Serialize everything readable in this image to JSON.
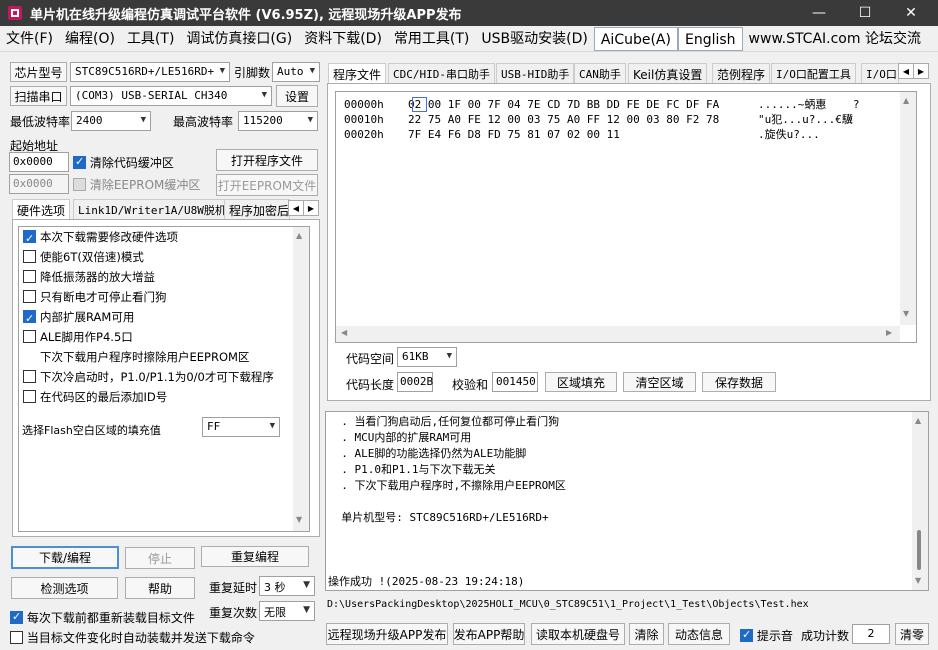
{
  "window": {
    "title": "单片机在线升级编程仿真调试平台软件 (V6.95Z), 远程现场升级APP发布"
  },
  "menu": [
    "文件(F)",
    "编程(O)",
    "工具(T)",
    "调试仿真接口(G)",
    "资料下载(D)",
    "常用工具(T)",
    "USB驱动安装(D)",
    "AiCube(A)",
    "English",
    "www.STCAI.com 论坛交流"
  ],
  "left": {
    "chip_label": "芯片型号",
    "chip_value": "STC89C516RD+/LE516RD+",
    "pin_label": "引脚数",
    "pin_value": "Auto",
    "scan_button": "扫描串口",
    "port_value": "(COM3) USB-SERIAL CH340",
    "settings_button": "设置",
    "min_baud_label": "最低波特率",
    "min_baud_value": "2400",
    "max_baud_label": "最高波特率",
    "max_baud_value": "115200",
    "start_addr_label": "起始地址",
    "code_addr_value": "0x0000",
    "clear_code_label": "清除代码缓冲区",
    "open_program_button": "打开程序文件",
    "eeprom_addr_value": "0x0000",
    "clear_eeprom_label": "清除EEPROM缓冲区",
    "open_eeprom_button": "打开EEPROM文件",
    "tabs": [
      "硬件选项",
      "Link1D/Writer1A/U8W脱机",
      "程序加密后"
    ],
    "options": [
      {
        "label": "本次下载需要修改硬件选项",
        "checked": true,
        "has_box": true
      },
      {
        "label": "使能6T(双倍速)模式",
        "checked": false,
        "has_box": true
      },
      {
        "label": "降低振荡器的放大增益",
        "checked": false,
        "has_box": true
      },
      {
        "label": "只有断电才可停止看门狗",
        "checked": false,
        "has_box": true
      },
      {
        "label": "内部扩展RAM可用",
        "checked": true,
        "has_box": true
      },
      {
        "label": "ALE脚用作P4.5口",
        "checked": false,
        "has_box": true
      },
      {
        "label": "下次下载用户程序时擦除用户EEPROM区",
        "checked": false,
        "has_box": false
      },
      {
        "label": "下次冷启动时，P1.0/P1.1为0/0才可下载程序",
        "checked": false,
        "has_box": true
      },
      {
        "label": "在代码区的最后添加ID号",
        "checked": false,
        "has_box": true
      }
    ],
    "fill_label": "选择Flash空白区域的填充值",
    "fill_value": "FF",
    "download_button": "下载/编程",
    "stop_button": "停止",
    "reprogram_button": "重复编程",
    "check_options_button": "检测选项",
    "help_button": "帮助",
    "repeat_delay_label": "重复延时",
    "repeat_delay_value": "3 秒",
    "repeat_count_label": "重复次数",
    "repeat_count_value": "无限",
    "reload_label": "每次下载前都重新装载目标文件",
    "auto_send_label": "当目标文件变化时自动装载并发送下载命令"
  },
  "right": {
    "tabs": [
      "程序文件",
      "CDC/HID-串口助手",
      "USB-HID助手",
      "CAN助手",
      "Keil仿真设置",
      "范例程序",
      "I/O口配置工具",
      "I/O口"
    ],
    "hex_rows": [
      {
        "addr": "00000h",
        "bytes": "02 00 1F 00 7F 04 7E CD 7D BB DD FE DE FC DF FA",
        "ascii": "......~蛃惠    ?"
      },
      {
        "addr": "00010h",
        "bytes": "22 75 A0 FE 12 00 03 75 A0 FF 12 00 03 80 F2 78",
        "ascii": "\"u犯...u?...€驥"
      },
      {
        "addr": "00020h",
        "bytes": "7F E4 F6 D8 FD 75 81 07 02 00 11",
        "ascii": ".旋佚u?..."
      }
    ],
    "code_space_label": "代码空间",
    "code_space_value": "61KB",
    "code_len_label": "代码长度",
    "code_len_value": "0002B",
    "checksum_label": "校验和",
    "checksum_value": "001450",
    "fill_region_button": "区域填充",
    "clear_region_button": "清空区域",
    "save_data_button": "保存数据",
    "log_lines": [
      "  . 当看门狗启动后,任何复位都可停止看门狗",
      "  . MCU内部的扩展RAM可用",
      "  . ALE脚的功能选择仍然为ALE功能脚",
      "  . P1.0和P1.1与下次下载无关",
      "  . 下次下载用户程序时,不擦除用户EEPROM区",
      "",
      "  单片机型号: STC89C516RD+/LE516RD+",
      "",
      "",
      "",
      "操作成功 !(2025-08-23 19:24:18)"
    ],
    "file_path": "D:\\UsersPackingDesktop\\2025HOLI_MCU\\0_STC89C51\\1_Project\\1_Test\\Objects\\Test.hex",
    "remote_publish_button": "远程现场升级APP发布",
    "publish_help_button": "发布APP帮助",
    "read_disk_button": "读取本机硬盘号",
    "clear_button": "清除",
    "dynamic_info_button": "动态信息",
    "beep_label": "提示音",
    "success_count_label": "成功计数",
    "success_count_value": "2",
    "reset_count_button": "清零"
  }
}
